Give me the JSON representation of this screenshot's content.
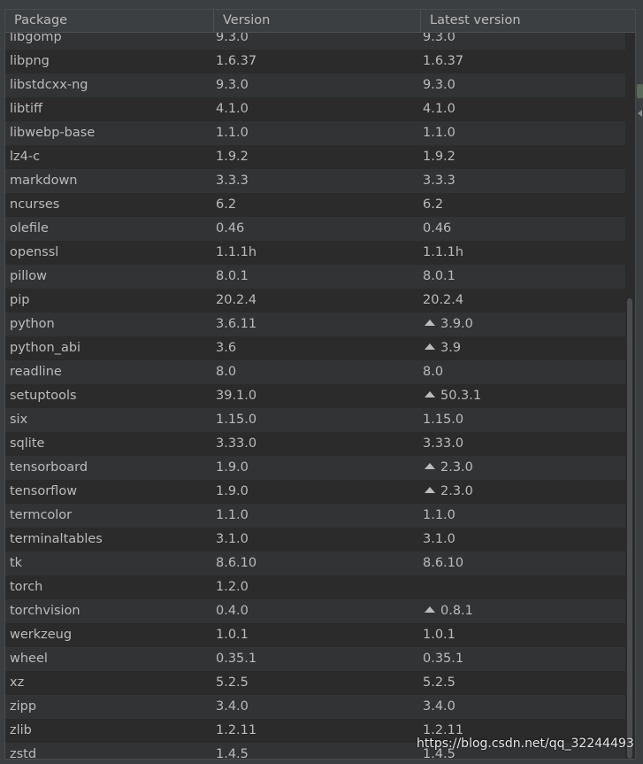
{
  "table": {
    "headers": [
      "Package",
      "Version",
      "Latest version"
    ],
    "partial_top_row": [
      "libgomp",
      "9.3.0",
      "9.3.0"
    ],
    "rows": [
      {
        "name": "libpng",
        "version": "1.6.37",
        "latest": "1.6.37",
        "upgrade": false
      },
      {
        "name": "libstdcxx-ng",
        "version": "9.3.0",
        "latest": "9.3.0",
        "upgrade": false
      },
      {
        "name": "libtiff",
        "version": "4.1.0",
        "latest": "4.1.0",
        "upgrade": false
      },
      {
        "name": "libwebp-base",
        "version": "1.1.0",
        "latest": "1.1.0",
        "upgrade": false
      },
      {
        "name": "lz4-c",
        "version": "1.9.2",
        "latest": "1.9.2",
        "upgrade": false
      },
      {
        "name": "markdown",
        "version": "3.3.3",
        "latest": "3.3.3",
        "upgrade": false
      },
      {
        "name": "ncurses",
        "version": "6.2",
        "latest": "6.2",
        "upgrade": false
      },
      {
        "name": "olefile",
        "version": "0.46",
        "latest": "0.46",
        "upgrade": false
      },
      {
        "name": "openssl",
        "version": "1.1.1h",
        "latest": "1.1.1h",
        "upgrade": false
      },
      {
        "name": "pillow",
        "version": "8.0.1",
        "latest": "8.0.1",
        "upgrade": false
      },
      {
        "name": "pip",
        "version": "20.2.4",
        "latest": "20.2.4",
        "upgrade": false
      },
      {
        "name": "python",
        "version": "3.6.11",
        "latest": "3.9.0",
        "upgrade": true
      },
      {
        "name": "python_abi",
        "version": "3.6",
        "latest": "3.9",
        "upgrade": true
      },
      {
        "name": "readline",
        "version": "8.0",
        "latest": "8.0",
        "upgrade": false
      },
      {
        "name": "setuptools",
        "version": "39.1.0",
        "latest": "50.3.1",
        "upgrade": true
      },
      {
        "name": "six",
        "version": "1.15.0",
        "latest": "1.15.0",
        "upgrade": false
      },
      {
        "name": "sqlite",
        "version": "3.33.0",
        "latest": "3.33.0",
        "upgrade": false
      },
      {
        "name": "tensorboard",
        "version": "1.9.0",
        "latest": "2.3.0",
        "upgrade": true
      },
      {
        "name": "tensorflow",
        "version": "1.9.0",
        "latest": "2.3.0",
        "upgrade": true
      },
      {
        "name": "termcolor",
        "version": "1.1.0",
        "latest": "1.1.0",
        "upgrade": false
      },
      {
        "name": "terminaltables",
        "version": "3.1.0",
        "latest": "3.1.0",
        "upgrade": false
      },
      {
        "name": "tk",
        "version": "8.6.10",
        "latest": "8.6.10",
        "upgrade": false
      },
      {
        "name": "torch",
        "version": "1.2.0",
        "latest": "",
        "upgrade": false
      },
      {
        "name": "torchvision",
        "version": "0.4.0",
        "latest": "0.8.1",
        "upgrade": true
      },
      {
        "name": "werkzeug",
        "version": "1.0.1",
        "latest": "1.0.1",
        "upgrade": false
      },
      {
        "name": "wheel",
        "version": "0.35.1",
        "latest": "0.35.1",
        "upgrade": false
      },
      {
        "name": "xz",
        "version": "5.2.5",
        "latest": "5.2.5",
        "upgrade": false
      },
      {
        "name": "zipp",
        "version": "3.4.0",
        "latest": "3.4.0",
        "upgrade": false
      },
      {
        "name": "zlib",
        "version": "1.2.11",
        "latest": "1.2.11",
        "upgrade": false
      },
      {
        "name": "zstd",
        "version": "1.4.5",
        "latest": "1.4.5",
        "upgrade": false
      }
    ]
  },
  "icons": {
    "upgrade": "triangle-up-icon"
  },
  "colors": {
    "background": "#2b2b2b",
    "row_alt": "#313335",
    "header": "#3c3f41",
    "text": "#bbbbbb"
  },
  "watermark": "https://blog.csdn.net/qq_32244493"
}
